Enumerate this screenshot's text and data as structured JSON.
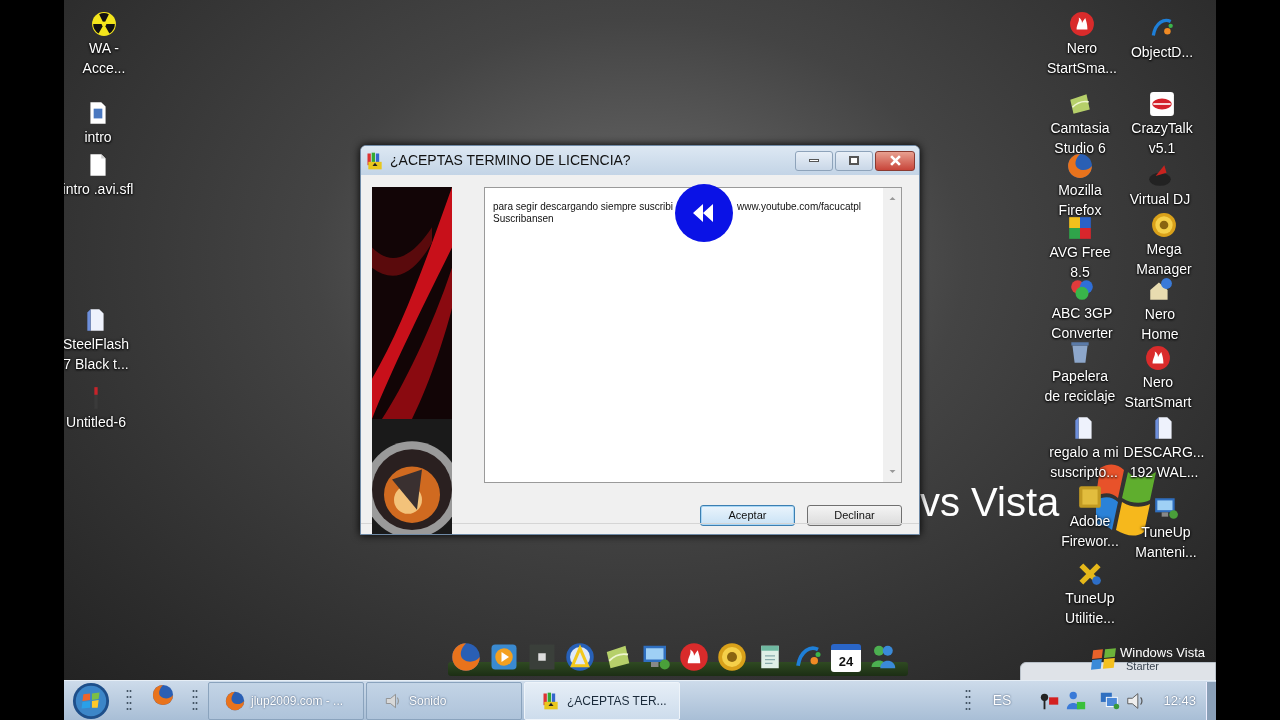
{
  "desktop_icons": [
    {
      "lines": [
        "WA -",
        "Acce..."
      ]
    },
    {
      "lines": [
        "intro"
      ]
    },
    {
      "lines": [
        "intro .avi.sfl"
      ]
    },
    {
      "lines": [
        "SteelFlash",
        "7 Black t..."
      ]
    },
    {
      "lines": [
        "Untitled-6"
      ]
    },
    {
      "lines": [
        "Nero",
        "StartSma..."
      ]
    },
    {
      "lines": [
        "Camtasia",
        "Studio 6"
      ]
    },
    {
      "lines": [
        "Mozilla",
        "Firefox"
      ]
    },
    {
      "lines": [
        "AVG Free",
        "8.5"
      ]
    },
    {
      "lines": [
        "ABC 3GP",
        "Converter"
      ]
    },
    {
      "lines": [
        "Papelera",
        "de reciclaje"
      ]
    },
    {
      "lines": [
        "regalo a mi",
        "suscripto..."
      ]
    },
    {
      "lines": [
        "Adobe",
        "Firewor..."
      ]
    },
    {
      "lines": [
        "TuneUp",
        "Utilitie..."
      ]
    },
    {
      "lines": [
        "ObjectD..."
      ]
    },
    {
      "lines": [
        "CrazyTalk",
        "v5.1"
      ]
    },
    {
      "lines": [
        "Virtual DJ"
      ]
    },
    {
      "lines": [
        "Mega",
        "Manager"
      ]
    },
    {
      "lines": [
        "Nero",
        "Home"
      ]
    },
    {
      "lines": [
        "Nero",
        "StartSmart"
      ]
    },
    {
      "lines": [
        "DESCARG...",
        "192 WAL..."
      ]
    },
    {
      "lines": [
        "TuneUp",
        "Manteni..."
      ]
    }
  ],
  "wallpaper_text": "vs Vista",
  "dialog": {
    "title": "¿ACEPTAS TERMINO DE LICENCIA?",
    "text_lines": [
      [
        "para segir descargando siempre suscribi",
        "www.youtube.com/facucatpl"
      ],
      [
        "Suscribansen"
      ]
    ],
    "buttons": [
      {
        "label": "Aceptar",
        "default": true
      },
      {
        "label": "Declinar",
        "default": false
      }
    ]
  },
  "dock": {
    "calendar_day": "24"
  },
  "edition": {
    "name": "Windows Vista",
    "edition": "Starter"
  },
  "taskbar": {
    "buttons": [
      {
        "label": "jlup2009.com - ...",
        "selected": false
      },
      {
        "label": "Sonido",
        "selected": false
      },
      {
        "label": "¿ACEPTAS TER...",
        "selected": true
      }
    ],
    "language": "ES",
    "clock": "12:43"
  }
}
